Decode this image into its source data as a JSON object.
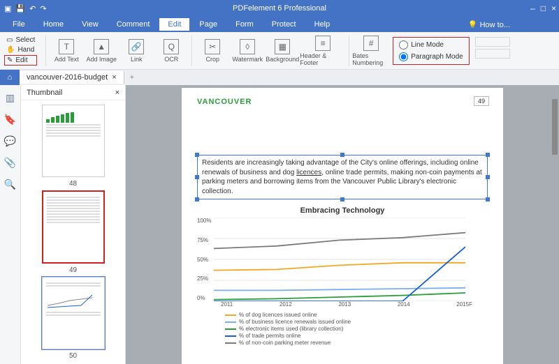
{
  "app_title": "PDFelement 6 Professional",
  "window_controls": [
    "–",
    "□",
    "×"
  ],
  "menu": {
    "items": [
      "File",
      "Home",
      "View",
      "Comment",
      "Edit",
      "Page",
      "Form",
      "Protect",
      "Help"
    ],
    "active": "Edit",
    "howto": "How to..."
  },
  "ribbon": {
    "mini": [
      {
        "label": "Select"
      },
      {
        "label": "Hand"
      },
      {
        "label": "Edit",
        "highlighted": true
      }
    ],
    "tools": [
      {
        "label": "Add Text"
      },
      {
        "label": "Add Image"
      },
      {
        "label": "Link"
      },
      {
        "label": "OCR"
      },
      {
        "label": "Crop"
      },
      {
        "label": "Watermark"
      },
      {
        "label": "Background"
      },
      {
        "label": "Header & Footer"
      },
      {
        "label": "Bates Numbering"
      }
    ],
    "modes": {
      "line": "Line Mode",
      "paragraph": "Paragraph Mode",
      "selected": "paragraph"
    }
  },
  "tabs": {
    "open": [
      {
        "label": "vancouver-2016-budget"
      }
    ]
  },
  "thumbnail": {
    "title": "Thumbnail",
    "close": "×",
    "pages": [
      "48",
      "49",
      "50"
    ],
    "current": "49"
  },
  "document": {
    "brand": "VANCOUVER",
    "page_no": "49",
    "paragraph": "Residents are increasingly taking advantage of the City's online offerings, including online renewals of business and dog licences, online trade permits, making non-coin payments at parking meters and borrowing items from the Vancouver Public Library's electronic collection."
  },
  "chart_data": {
    "type": "line",
    "title": "Embracing Technology",
    "xlabel": "",
    "ylabel": "",
    "categories": [
      "2011",
      "2012",
      "2013",
      "2014",
      "2015F"
    ],
    "y_ticks": [
      "100%",
      "75%",
      "50%",
      "25%",
      "0%"
    ],
    "ylim": [
      0,
      100
    ],
    "series": [
      {
        "name": "% of dog licences issued online",
        "color": "#f5a623",
        "values": [
          37,
          38,
          43,
          46,
          46
        ]
      },
      {
        "name": "% of business licence renewals issued online",
        "color": "#7aaef0",
        "values": [
          13,
          13,
          14,
          15,
          16
        ]
      },
      {
        "name": "% electronic items used (library collection)",
        "color": "#2a9d3a",
        "values": [
          2,
          3,
          5,
          7,
          10
        ]
      },
      {
        "name": "% of trade permits online",
        "color": "#1560d8",
        "values": [
          0,
          0,
          0,
          0,
          65
        ]
      },
      {
        "name": "% of non-coin parking meter revenue",
        "color": "#7a7a7a",
        "values": [
          63,
          66,
          73,
          76,
          82
        ]
      }
    ]
  }
}
